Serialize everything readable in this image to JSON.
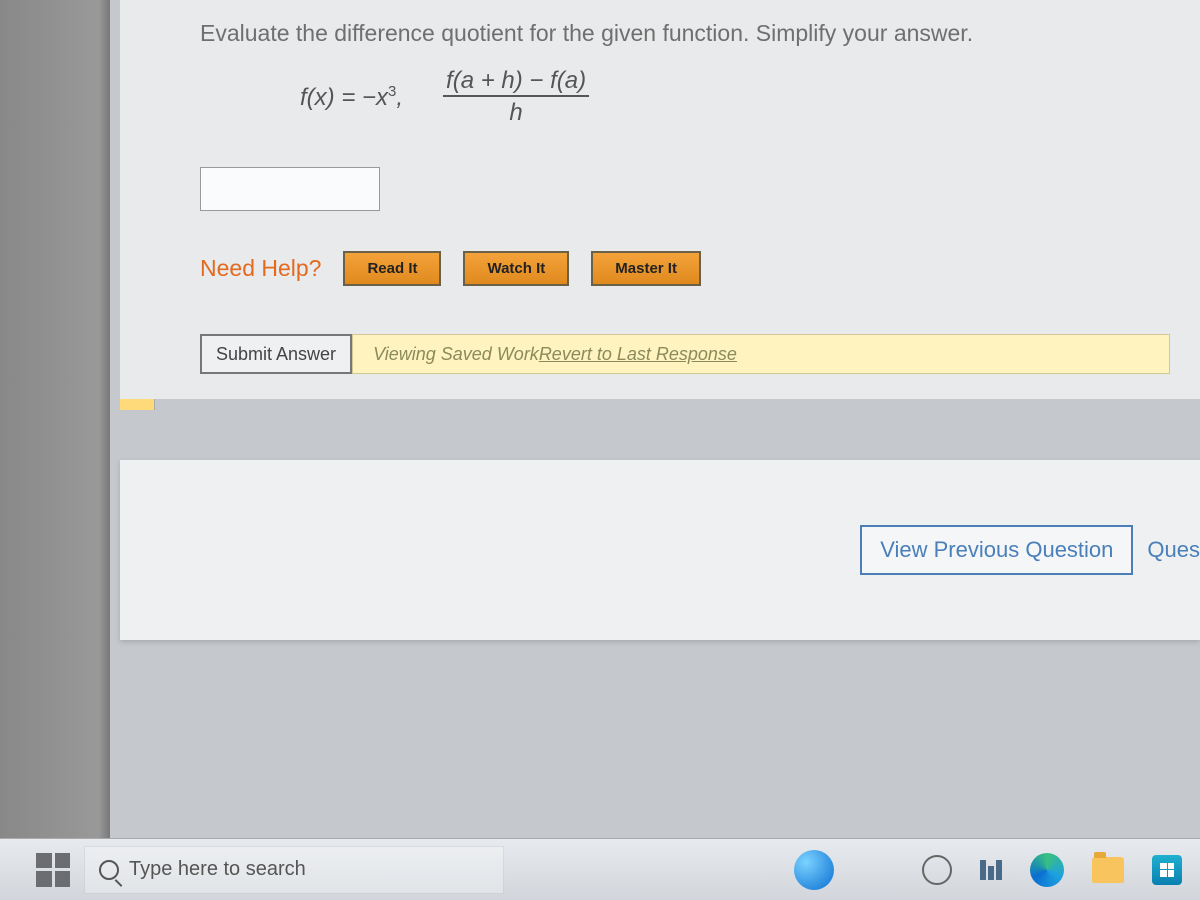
{
  "question": {
    "prompt": "Evaluate the difference quotient for the given function. Simplify your answer.",
    "function_def": "f(x) = −x³,",
    "fraction_numerator": "f(a + h) − f(a)",
    "fraction_denominator": "h"
  },
  "help": {
    "label": "Need Help?",
    "read": "Read It",
    "watch": "Watch It",
    "master": "Master It"
  },
  "submit": {
    "button": "Submit Answer",
    "saved_work_prefix": "Viewing Saved Work ",
    "revert_link": "Revert to Last Response"
  },
  "nav": {
    "view_previous": "View Previous Question",
    "next_partial": "Ques"
  },
  "taskbar": {
    "search_placeholder": "Type here to search"
  }
}
